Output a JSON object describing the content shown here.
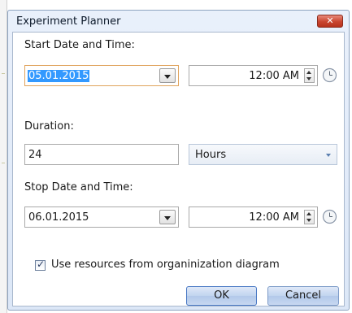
{
  "window": {
    "title": "Experiment Planner",
    "close_glyph": "✕"
  },
  "start": {
    "label": "Start Date and Time:",
    "date": "05.01.2015",
    "time": "12:00 AM"
  },
  "duration": {
    "label": "Duration:",
    "value": "24",
    "unit": "Hours"
  },
  "stop": {
    "label": "Stop Date and Time:",
    "date": "06.01.2015",
    "time": "12:00 AM"
  },
  "resources": {
    "checked": true,
    "label": "Use resources from organinization diagram"
  },
  "buttons": {
    "ok": "OK",
    "cancel": "Cancel"
  },
  "icons": {
    "close": "close-icon",
    "dropdown": "chevron-down-icon",
    "spinner": "spinner-icon",
    "clock": "clock-icon",
    "check": "checkmark-icon"
  },
  "colors": {
    "selection": "#3399ff",
    "focus_border": "#e0a35c",
    "close_button": "#c9452f",
    "dialog_frame": "#dce7f7"
  }
}
